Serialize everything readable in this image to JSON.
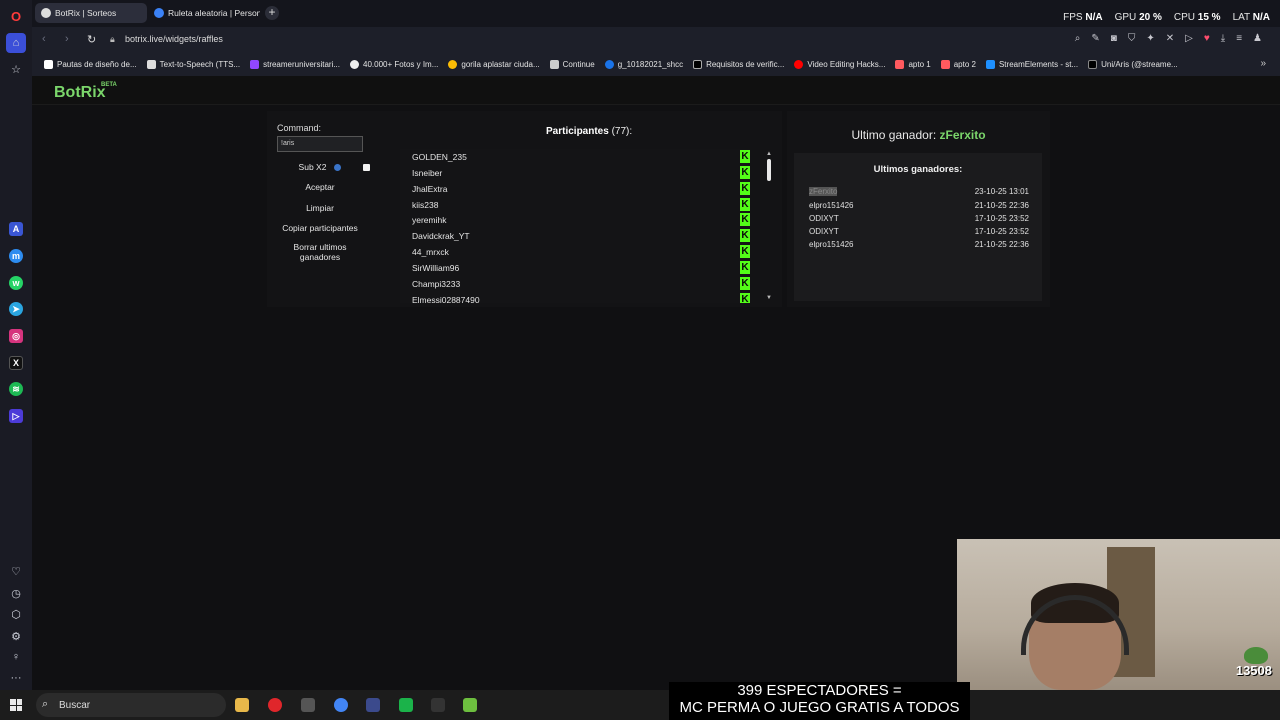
{
  "browser": {
    "tabs": [
      {
        "label": "BotRix | Sorteos",
        "active": true
      },
      {
        "label": "Ruleta aleatoria | Personal",
        "active": false
      }
    ],
    "new_tab_label": "+",
    "perf": {
      "fps_label": "FPS",
      "fps_value": "N/A",
      "gpu_label": "GPU",
      "gpu_value": "20 %",
      "cpu_label": "CPU",
      "cpu_value": "15 %",
      "lat_label": "LAT",
      "lat_value": "N/A"
    },
    "url": "botrix.live/widgets/raffles",
    "bookmarks": [
      "Pautas de diseño de...",
      "Text-to-Speech (TTS...",
      "streameruniversitari...",
      "40.000+ Fotos y Im...",
      "gorila aplastar ciuda...",
      "Continue",
      "g_10182021_shcc",
      "Requisitos de verific...",
      "Video Editing Hacks...",
      "apto 1",
      "apto 2",
      "StreamElements - st...",
      "Uni/Aris (@streame..."
    ]
  },
  "app": {
    "logo": "BotRix",
    "logo_badge": "BETA"
  },
  "raffle": {
    "command_label": "Command:",
    "command_value": "!aris",
    "sub_option_label": "Sub X2",
    "accept_label": "Aceptar",
    "clear_label": "Limpiar",
    "copy_participants_label": "Copiar participantes",
    "delete_winners_label": "Borrar ultimos ganadores",
    "participants_title": "Participantes",
    "participants_count": "(77):",
    "participants": [
      "GOLDEN_235",
      "Isneiber",
      "JhalExtra",
      "kiis238",
      "yeremihk",
      "Davidckrak_YT",
      "44_mrxck",
      "SirWilliam96",
      "Champi3233",
      "Elmessi02887490"
    ],
    "platform_badge": "K",
    "last_winner_label": "Ultimo ganador:",
    "last_winner_name": "zFerxito",
    "recent_winners_title": "Ultimos ganadores:",
    "recent_winners": [
      {
        "name": "zFerxito",
        "date": "23-10-25 13:01"
      },
      {
        "name": "elpro151426",
        "date": "21-10-25 22:36"
      },
      {
        "name": "ODIXYT",
        "date": "17-10-25 23:52"
      },
      {
        "name": "ODIXYT",
        "date": "17-10-25 23:52"
      },
      {
        "name": "elpro151426",
        "date": "21-10-25 22:36"
      }
    ]
  },
  "stream": {
    "viewer_counter": "13508",
    "overlay_line1": "399 ESPECTADORES =",
    "overlay_line2": "MC PERMA O JUEGO GRATIS A TODOS"
  },
  "taskbar": {
    "search_label": "Buscar"
  },
  "colors": {
    "accent_green": "#7bd66b",
    "kick_green": "#53fc18"
  }
}
